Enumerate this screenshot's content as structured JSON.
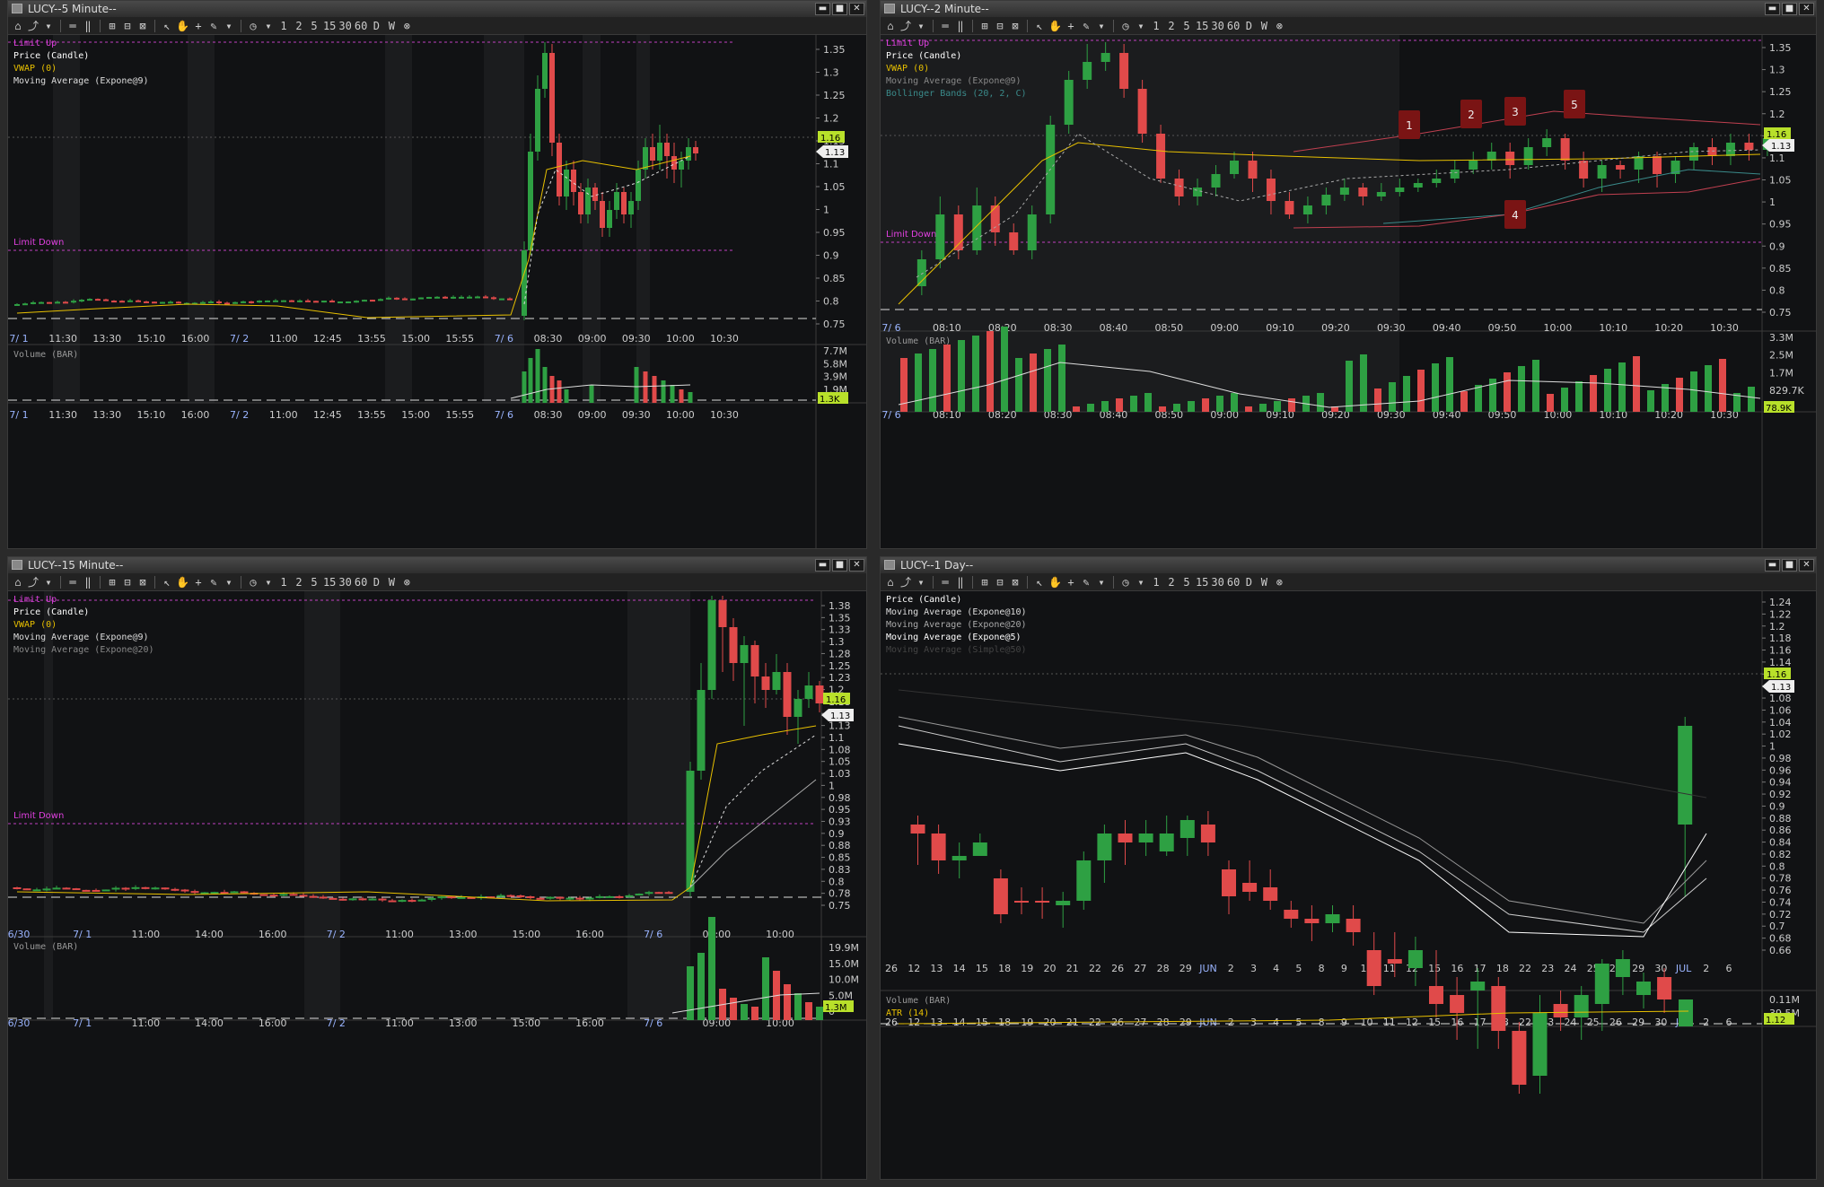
{
  "toolbar": {
    "timeframes": [
      "1",
      "2",
      "5",
      "15",
      "30",
      "60",
      "D",
      "W"
    ]
  },
  "windows": [
    {
      "id": "w5m",
      "title": "LUCY--5 Minute--",
      "legend": [
        {
          "text": "Limit Up",
          "color": "#e040e0"
        },
        {
          "text": "Price (Candle)",
          "color": "#ffffff"
        },
        {
          "text": "VWAP (0)",
          "color": "#e8c000"
        },
        {
          "text": "Moving Average (Expone@9)",
          "color": "#dddddd"
        }
      ],
      "limit_down_label": "Limit Down",
      "price_ticks": [
        "1.35",
        "1.3",
        "1.25",
        "1.2",
        "1.15",
        "1.1",
        "1.05",
        "1",
        "0.95",
        "0.9",
        "0.85",
        "0.8",
        "0.75"
      ],
      "time_ticks": [
        "7/ 1",
        "11:30",
        "13:30",
        "15:10",
        "16:00",
        "7/ 2",
        "11:00",
        "12:45",
        "13:55",
        "15:00",
        "15:55",
        "7/ 6",
        "08:30",
        "09:00",
        "09:30",
        "10:00",
        "10:30"
      ],
      "vol_label": "Volume (BAR)",
      "vol_ticks": [
        "7.7M",
        "5.8M",
        "3.9M",
        "1.9M"
      ],
      "last_price": "1.13",
      "last_vol": "1.3K",
      "bid_tag": "1.16"
    },
    {
      "id": "w2m",
      "title": "LUCY--2 Minute--",
      "legend": [
        {
          "text": "Limit Up",
          "color": "#e040e0"
        },
        {
          "text": "Price (Candle)",
          "color": "#ffffff"
        },
        {
          "text": "VWAP (0)",
          "color": "#e8c000"
        },
        {
          "text": "Moving Average (Expone@9)",
          "color": "#888888"
        },
        {
          "text": "Bollinger Bands (20, 2, C)",
          "color": "#3a8a8a"
        }
      ],
      "limit_down_label": "Limit Down",
      "price_ticks": [
        "1.35",
        "1.3",
        "1.25",
        "1.2",
        "1.15",
        "1.1",
        "1.05",
        "1",
        "0.95",
        "0.9",
        "0.85",
        "0.8",
        "0.75"
      ],
      "time_ticks": [
        "7/ 6",
        "08:10",
        "08:20",
        "08:30",
        "08:40",
        "08:50",
        "09:00",
        "09:10",
        "09:20",
        "09:30",
        "09:40",
        "09:50",
        "10:00",
        "10:10",
        "10:20",
        "10:30"
      ],
      "vol_label": "Volume (BAR)",
      "vol_ticks": [
        "3.3M",
        "2.5M",
        "1.7M",
        "829.7K"
      ],
      "last_price": "1.13",
      "last_vol": "78.9K",
      "bid_tag": "1.16",
      "markers": [
        "1",
        "2",
        "3",
        "4",
        "5"
      ]
    },
    {
      "id": "w15m",
      "title": "LUCY--15 Minute--",
      "legend": [
        {
          "text": "Limit Up",
          "color": "#e040e0"
        },
        {
          "text": "Price (Candle)",
          "color": "#ffffff"
        },
        {
          "text": "VWAP (0)",
          "color": "#e8c000"
        },
        {
          "text": "Moving Average (Expone@9)",
          "color": "#dddddd"
        },
        {
          "text": "Moving Average (Expone@20)",
          "color": "#888888"
        }
      ],
      "limit_down_label": "Limit Down",
      "price_ticks": [
        "1.38",
        "1.35",
        "1.33",
        "1.3",
        "1.28",
        "1.25",
        "1.23",
        "1.2",
        "1.18",
        "1.15",
        "1.13",
        "1.1",
        "1.08",
        "1.05",
        "1.03",
        "1",
        "0.98",
        "0.95",
        "0.93",
        "0.9",
        "0.88",
        "0.85",
        "0.83",
        "0.8",
        "0.78",
        "0.75"
      ],
      "time_ticks": [
        "6/30",
        "7/ 1",
        "11:00",
        "14:00",
        "16:00",
        "7/ 2",
        "11:00",
        "13:00",
        "15:00",
        "16:00",
        "7/ 6",
        "09:00",
        "10:00"
      ],
      "vol_label": "Volume (BAR)",
      "vol_ticks": [
        "19.9M",
        "15.0M",
        "10.0M",
        "5.0M",
        "0"
      ],
      "last_price": "1.13",
      "last_vol": "1.3M",
      "bid_tag": "1.16"
    },
    {
      "id": "w1d",
      "title": "LUCY--1 Day--",
      "legend": [
        {
          "text": "Price (Candle)",
          "color": "#ffffff"
        },
        {
          "text": "Moving Average (Expone@10)",
          "color": "#dddddd"
        },
        {
          "text": "Moving Average (Expone@20)",
          "color": "#aaaaaa"
        },
        {
          "text": "Moving Average (Expone@5)",
          "color": "#ffffff"
        },
        {
          "text": "Moving Average (Simple@50)",
          "color": "#444444"
        }
      ],
      "price_ticks": [
        "1.24",
        "1.22",
        "1.2",
        "1.18",
        "1.16",
        "1.14",
        "1.12",
        "1.1",
        "1.08",
        "1.06",
        "1.04",
        "1.02",
        "1",
        "0.98",
        "0.96",
        "0.94",
        "0.92",
        "0.9",
        "0.88",
        "0.86",
        "0.84",
        "0.82",
        "0.8",
        "0.78",
        "0.76",
        "0.74",
        "0.72",
        "0.7",
        "0.68",
        "0.66"
      ],
      "time_ticks": [
        "26",
        "12",
        "13",
        "14",
        "15",
        "18",
        "19",
        "20",
        "21",
        "22",
        "26",
        "27",
        "28",
        "29",
        "JUN",
        "2",
        "3",
        "4",
        "5",
        "8",
        "9",
        "10",
        "11",
        "12",
        "15",
        "16",
        "17",
        "18",
        "22",
        "23",
        "24",
        "25",
        "26",
        "29",
        "30",
        "JUL",
        "2",
        "6"
      ],
      "vol_label": "Volume (BAR)",
      "atr_label": "ATR (14)",
      "vol_ticks": [
        "0.11M",
        "39.5M"
      ],
      "last_price": "1.13",
      "last_vol": "1.12",
      "bid_tag": "1.16"
    }
  ],
  "colors": {
    "up": "#2ea043",
    "down": "#e04a4a",
    "grid": "#2a2a2a",
    "bg": "#111214",
    "session": "#1b1c1e"
  }
}
